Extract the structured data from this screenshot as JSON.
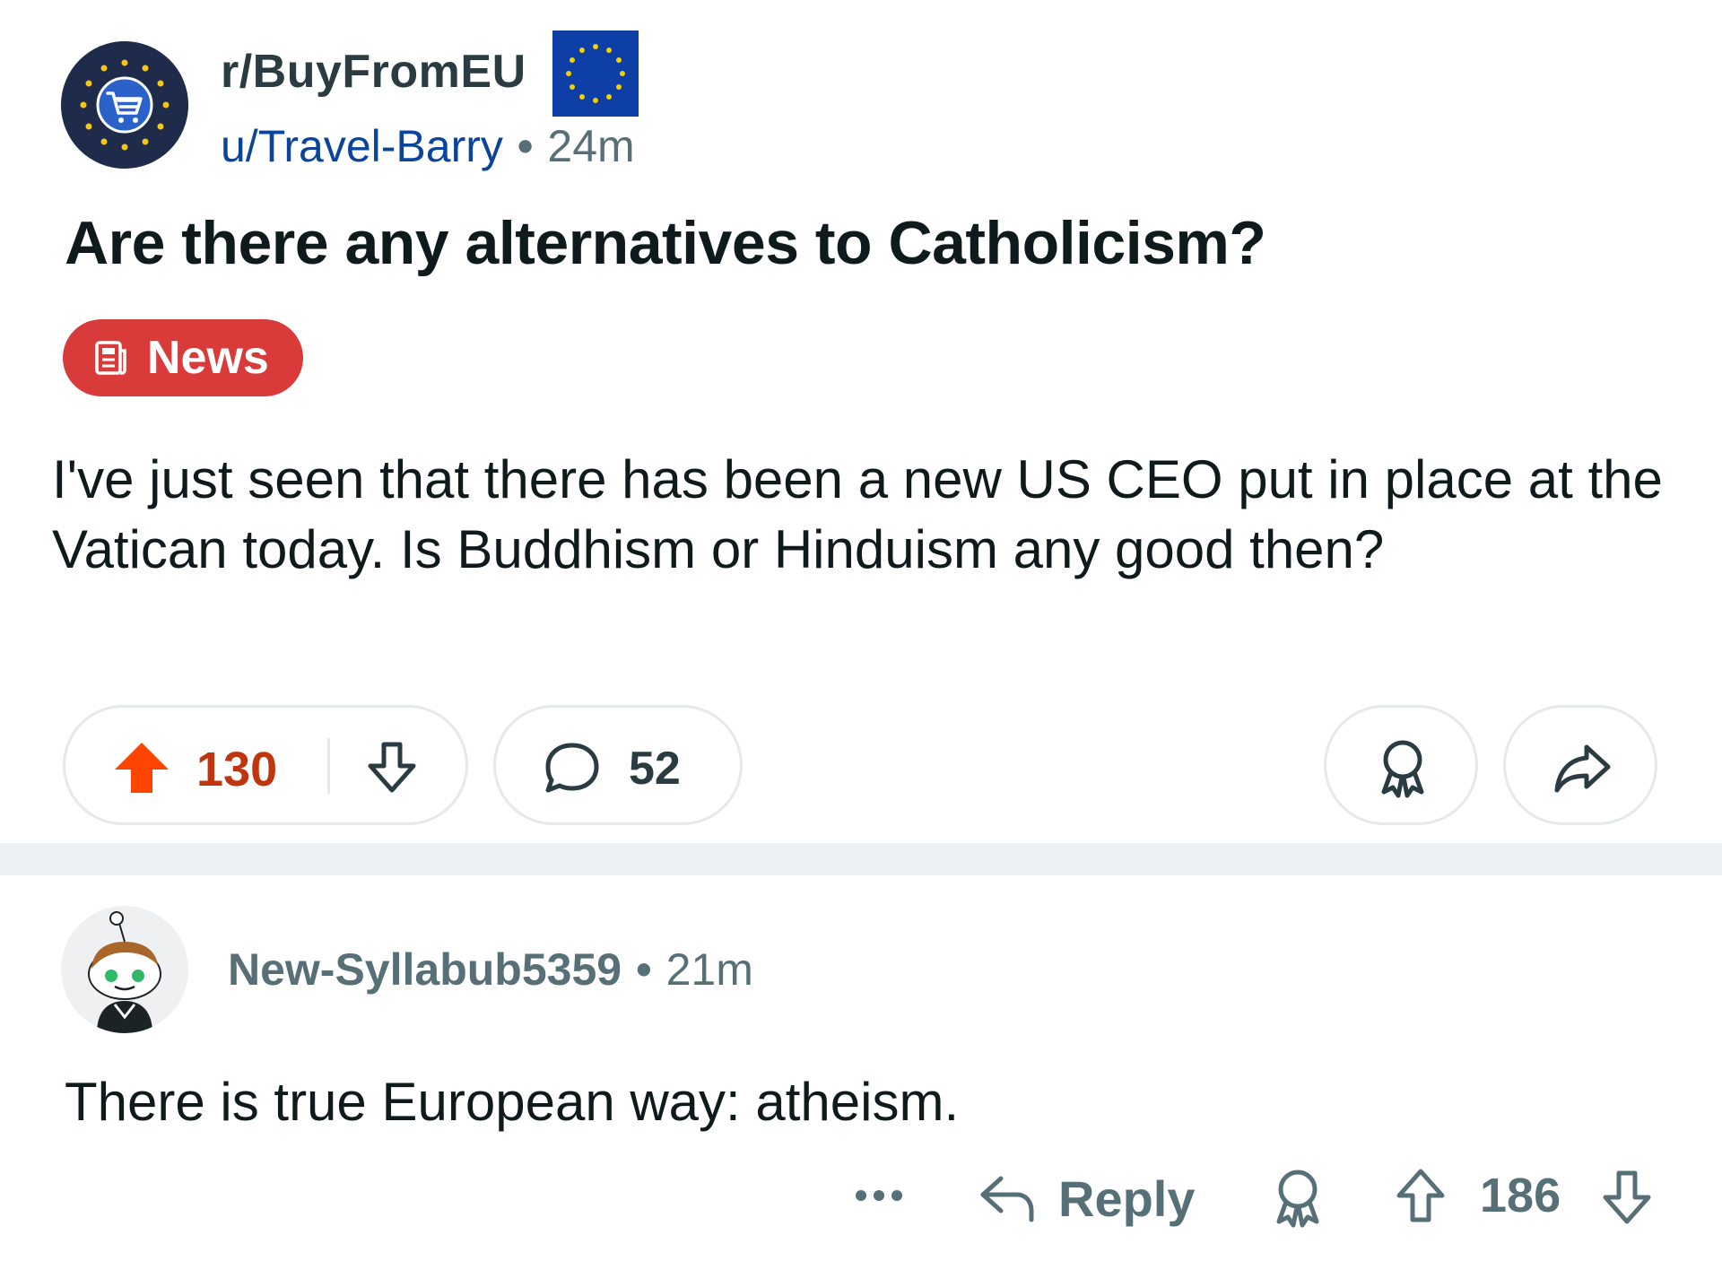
{
  "post": {
    "subreddit": "r/BuyFromEU",
    "author": "u/Travel-Barry",
    "separator": "•",
    "age": "24m",
    "title": "Are there any alternatives to Catholicism?",
    "flair": "News",
    "body": "I've just seen that there has been a new US CEO put in place at the Vatican today. Is Buddhism or Hinduism any good then?",
    "upvotes": "130",
    "comments": "52"
  },
  "comment": {
    "author": "New-Syllabub5359",
    "separator": "•",
    "age": "21m",
    "body": "There is true European way: atheism.",
    "reply_label": "Reply",
    "upvotes": "186"
  },
  "icons": {
    "subreddit_avatar": "eu-shopping-cart-icon",
    "flag": "eu-flag-icon",
    "flair": "newspaper-icon",
    "upvote": "upvote-arrow-icon",
    "downvote": "downvote-arrow-icon",
    "comment": "speech-bubble-icon",
    "award": "award-ribbon-icon",
    "share": "share-arrow-icon",
    "more": "more-dots-icon",
    "reply": "reply-arrow-icon"
  },
  "colors": {
    "upvote_active": "#ff4500",
    "vote_count_active": "#c0350d",
    "flair_bg": "#d93a3a",
    "author_link": "#0a449b",
    "muted_text": "#576f76"
  }
}
